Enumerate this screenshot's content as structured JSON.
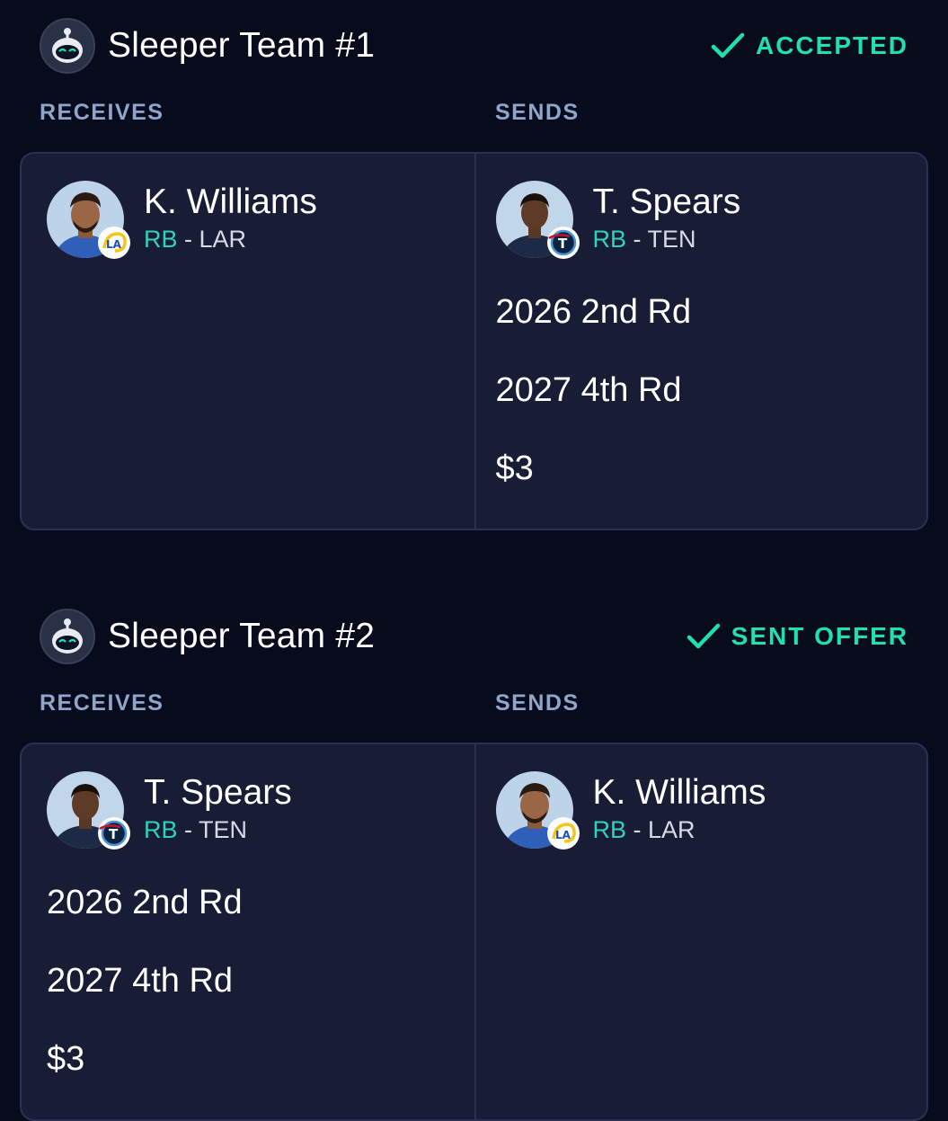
{
  "trade1": {
    "team_name": "Sleeper Team #1",
    "status": "ACCEPTED",
    "receives_label": "RECEIVES",
    "sends_label": "SENDS",
    "receives": {
      "player": {
        "name": "K. Williams",
        "position": "RB",
        "separator": " - ",
        "team": "LAR"
      },
      "picks": []
    },
    "sends": {
      "player": {
        "name": "T. Spears",
        "position": "RB",
        "separator": " - ",
        "team": "TEN"
      },
      "picks": [
        "2026 2nd Rd",
        "2027 4th Rd",
        "$3"
      ]
    }
  },
  "trade2": {
    "team_name": "Sleeper Team #2",
    "status": "SENT OFFER",
    "receives_label": "RECEIVES",
    "sends_label": "SENDS",
    "receives": {
      "player": {
        "name": "T. Spears",
        "position": "RB",
        "separator": " - ",
        "team": "TEN"
      },
      "picks": [
        "2026 2nd Rd",
        "2027 4th Rd",
        "$3"
      ]
    },
    "sends": {
      "player": {
        "name": "K. Williams",
        "position": "RB",
        "separator": " - ",
        "team": "LAR"
      },
      "picks": []
    }
  },
  "colors": {
    "background": "#070b1c",
    "card": "#181d35",
    "accent": "#1fe0b0",
    "position": "#2fd3b8",
    "label": "#8fa6cc"
  },
  "icons": {
    "team_avatar": "robot-avatar-icon",
    "status": "checkmark-icon",
    "rams_logo": "rams-logo-icon",
    "titans_logo": "titans-logo-icon"
  }
}
